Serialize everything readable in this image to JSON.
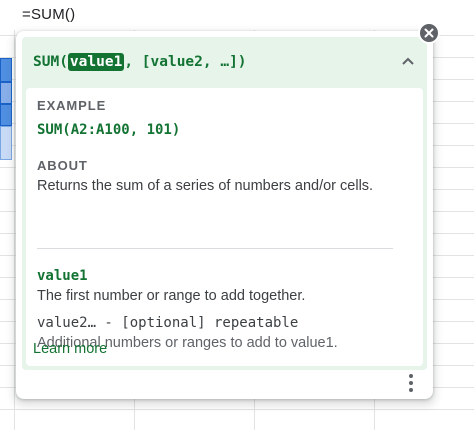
{
  "formula_bar": {
    "text": "=SUM()"
  },
  "tooltip": {
    "signature": {
      "prefix": "SUM(",
      "active_arg": "value1",
      "suffix": ", [value2, …])"
    },
    "collapse_icon": "chevron-up-icon",
    "example": {
      "heading": "EXAMPLE",
      "code": "SUM(A2:A100, 101)"
    },
    "about": {
      "heading": "ABOUT",
      "text": "Returns the sum of a series of numbers and/or cells."
    },
    "arguments": [
      {
        "name": "value1",
        "description": "The first number or range to add together."
      },
      {
        "name": "value2… - [optional] repeatable",
        "description": "Additional numbers or ranges to add to value1."
      }
    ],
    "learn_more": "Learn more",
    "more_icon": "more-vert-icon",
    "close_icon": "close-icon"
  },
  "colors": {
    "accent_green": "#137333",
    "panel_green_bg": "#e6f4ea",
    "selection_blue": "#4f8ee0"
  }
}
